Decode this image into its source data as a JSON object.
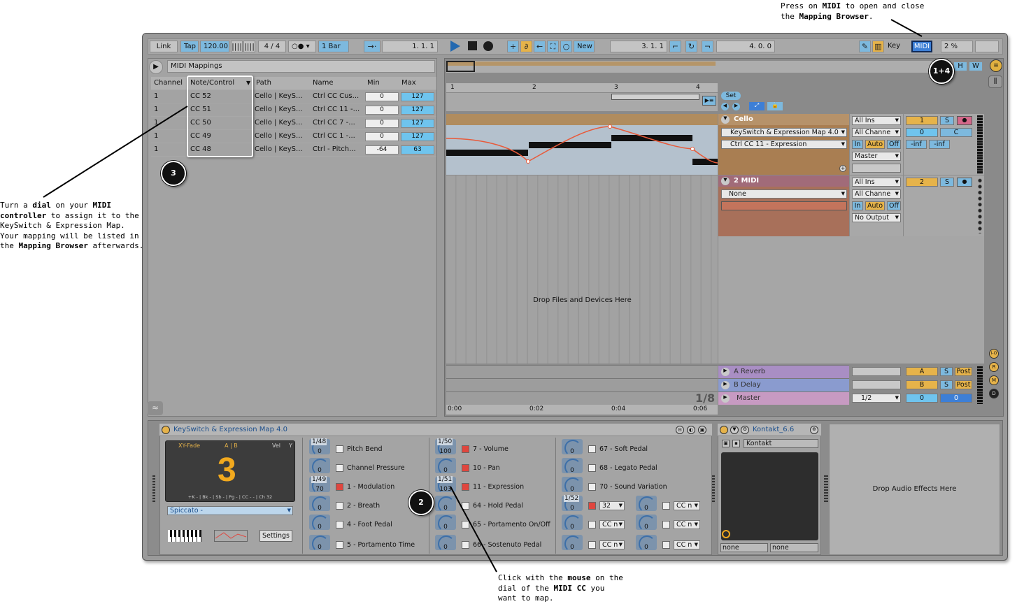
{
  "annotations": {
    "top_l1a": "Press on ",
    "top_l1b": "MIDI",
    "top_l1c": " to open and close",
    "top_l2a": "the ",
    "top_l2b": "Mapping Browser",
    "top_l2c": ".",
    "left_l1a": "Turn a ",
    "left_l1b": "dial",
    "left_l1c": " on your ",
    "left_l1d": "MIDI",
    "left_l2a": "controller",
    "left_l2b": " to assign it to the",
    "left_l3": "KeySwitch & Expression Map.",
    "left_l4": "Your mapping will be listed in",
    "left_l5a": "the ",
    "left_l5b": "Mapping Browser",
    "left_l5c": " afterwards.",
    "bot_l1a": "Click with the ",
    "bot_l1b": "mouse",
    "bot_l1c": " on the",
    "bot_l2a": "dial of the ",
    "bot_l2b": "MIDI CC",
    "bot_l2c": " you",
    "bot_l3": "want to map."
  },
  "callouts": {
    "c3": "3",
    "c14": "1+4",
    "c2": "2"
  },
  "transport": {
    "link": "Link",
    "tap": "Tap",
    "tempo": "120.00",
    "signature": "4 / 4",
    "quant": "1 Bar",
    "position": "1.   1.   1",
    "loop_start": "3.   1.   1",
    "loop_len": "4.   0.   0",
    "new": "New",
    "key": "Key",
    "midi": "MIDI",
    "cpu": "2 %"
  },
  "mappings": {
    "title": "MIDI Mappings",
    "headers": [
      "Channel",
      "Note/Control",
      "Path",
      "Name",
      "Min",
      "Max"
    ],
    "rows": [
      {
        "ch": "1",
        "cc": "CC 52",
        "path": "Cello | KeyS...",
        "name": "Ctrl CC Cus...",
        "min": "0",
        "max": "127"
      },
      {
        "ch": "1",
        "cc": "CC 51",
        "path": "Cello | KeyS...",
        "name": "Ctrl CC 11 -...",
        "min": "0",
        "max": "127"
      },
      {
        "ch": "1",
        "cc": "CC 50",
        "path": "Cello | KeyS...",
        "name": "Ctrl CC  7 -...",
        "min": "0",
        "max": "127"
      },
      {
        "ch": "1",
        "cc": "CC 49",
        "path": "Cello | KeyS...",
        "name": "Ctrl CC  1 -...",
        "min": "0",
        "max": "127"
      },
      {
        "ch": "1",
        "cc": "CC 48",
        "path": "Cello | KeyS...",
        "name": "Ctrl -  Pitch...",
        "min": "-64",
        "max": "63"
      }
    ]
  },
  "arrangement": {
    "ruler": [
      "1",
      "2",
      "3",
      "4"
    ],
    "set": "Set",
    "drop": "Drop Files and Devices Here",
    "zoom": "1/8",
    "times": [
      "0:00",
      "0:02",
      "0:04",
      "0:06"
    ],
    "H": "H",
    "W": "W"
  },
  "tracks": {
    "cello": {
      "name": "Cello",
      "dev1": "KeySwitch & Expression Map 4.0",
      "dev2": "Ctrl CC 11 - Expression",
      "in": "All Ins",
      "ch": "All Channe",
      "in_btn": "In",
      "auto": "Auto",
      "off": "Off",
      "out": "Master",
      "num": "1",
      "s": "S",
      "vol": "0",
      "pan": "C",
      "inf1": "-inf",
      "inf2": "-inf"
    },
    "midi2": {
      "name": "2 MIDI",
      "dev": "None",
      "in": "All Ins",
      "ch": "All Channe",
      "in_btn": "In",
      "auto": "Auto",
      "off": "Off",
      "out": "No Output",
      "num": "2",
      "s": "S"
    },
    "reverb": {
      "name": "A Reverb",
      "letter": "A",
      "s": "S",
      "post": "Post"
    },
    "delay": {
      "name": "B Delay",
      "letter": "B",
      "s": "S",
      "post": "Post"
    },
    "master": {
      "name": "Master",
      "cue": "1/2",
      "vol1": "0",
      "vol2": "0"
    },
    "io": [
      "I-O",
      "R",
      "M",
      "D"
    ]
  },
  "device": {
    "title": "KeySwitch & Expression Map 4.0",
    "xy": "XY-Fade",
    "ab": "A | B",
    "vel": "Vel",
    "y": "Y",
    "big": "3",
    "keys": "+K - | Bk - | Sb - | Pg - | CC - - | Ch 32",
    "preset": "Spiccato -",
    "settings": "Settings",
    "col1": [
      {
        "k": "1/48",
        "v": "0",
        "label": "Pitch Bend",
        "on": false
      },
      {
        "k": "",
        "v": "0",
        "label": "Channel Pressure",
        "on": false
      },
      {
        "k": "1/49",
        "v": "70",
        "label": "1 - Modulation",
        "on": true
      },
      {
        "k": "",
        "v": "0",
        "label": "2 - Breath",
        "on": false
      },
      {
        "k": "",
        "v": "0",
        "label": "4 - Foot Pedal",
        "on": false
      },
      {
        "k": "",
        "v": "0",
        "label": "5 - Portamento Time",
        "on": false
      }
    ],
    "col2": [
      {
        "k": "1/50",
        "v": "100",
        "label": "7 - Volume",
        "on": true
      },
      {
        "k": "",
        "v": "0",
        "label": "10 - Pan",
        "on": true
      },
      {
        "k": "1/51",
        "v": "103",
        "label": "11 - Expression",
        "on": true
      },
      {
        "k": "",
        "v": "0",
        "label": "64 - Hold Pedal",
        "on": false
      },
      {
        "k": "",
        "v": "0",
        "label": "65 - Portamento On/Off",
        "on": false
      },
      {
        "k": "",
        "v": "0",
        "label": "66 - Sostenuto Pedal",
        "on": false
      }
    ],
    "col3": [
      {
        "k": "",
        "v": "0",
        "label": "67 - Soft Pedal"
      },
      {
        "k": "",
        "v": "0",
        "label": "68 - Legato Pedal"
      },
      {
        "k": "",
        "v": "0",
        "label": "70 - Sound Variation"
      }
    ],
    "col3b": {
      "k": "1/52",
      "v": "0",
      "sel": "32",
      "cc": "CC n"
    },
    "kontakt": {
      "title": "Kontakt_6.6",
      "inst": "Kontakt",
      "n1": "none",
      "n2": "none"
    },
    "drop_fx": "Drop Audio Effects Here"
  }
}
